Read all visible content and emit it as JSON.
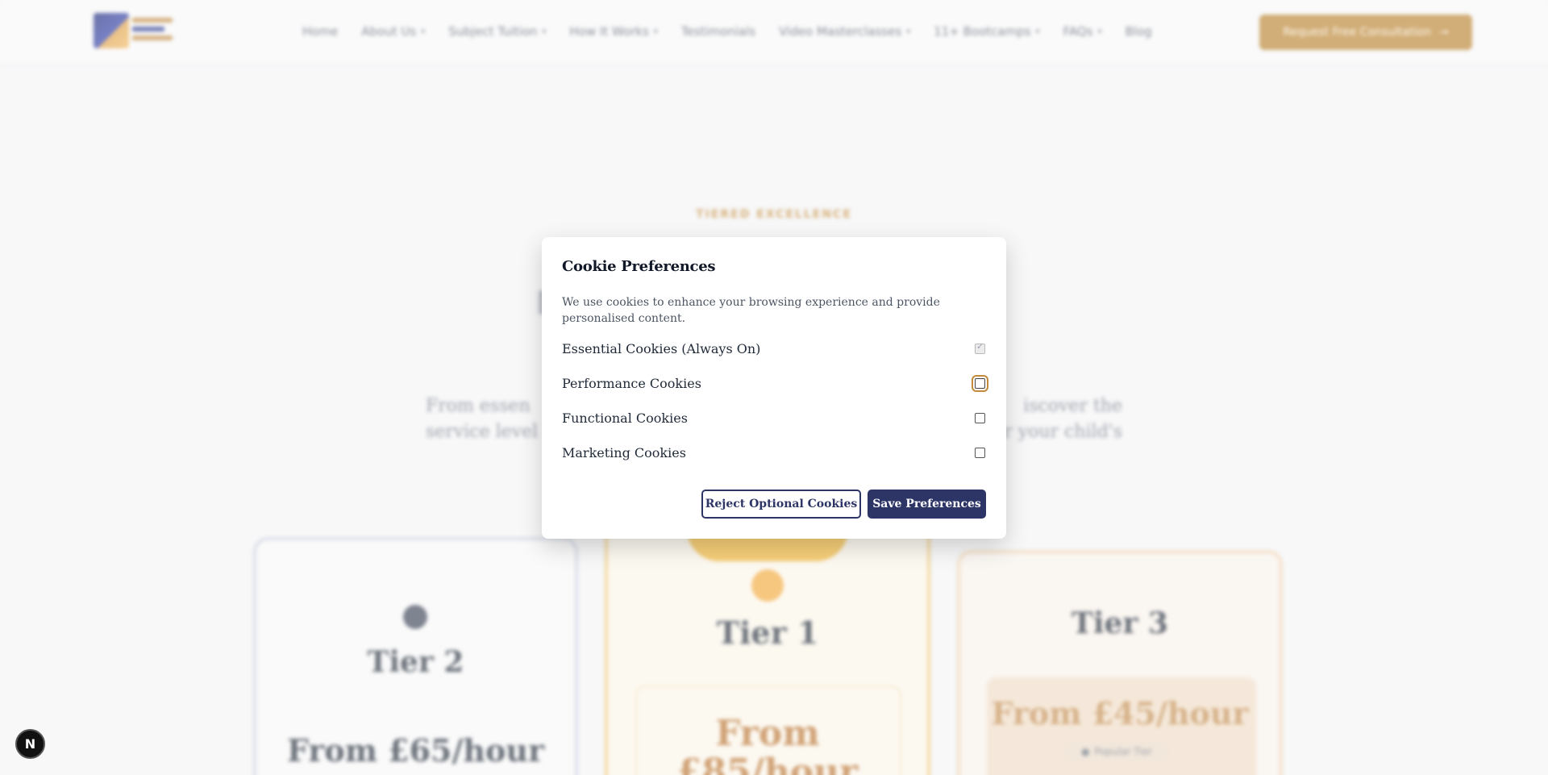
{
  "header": {
    "nav": [
      {
        "label": "Home",
        "chevron": false
      },
      {
        "label": "About Us",
        "chevron": true
      },
      {
        "label": "Subject Tuition",
        "chevron": true
      },
      {
        "label": "How It Works",
        "chevron": true
      },
      {
        "label": "Testimonials",
        "chevron": false
      },
      {
        "label": "Video Masterclasses",
        "chevron": true
      },
      {
        "label": "11+ Bootcamps",
        "chevron": true
      },
      {
        "label": "FAQs",
        "chevron": true
      },
      {
        "label": "Blog",
        "chevron": false
      }
    ],
    "cta_label": "Request Free Consultation",
    "cta_icon": "arrow-right-icon"
  },
  "hero": {
    "eyebrow": "TIERED EXCELLENCE",
    "intro_left_1": "From essen",
    "intro_right_1": "iscover the",
    "intro_left_2": "service level",
    "intro_right_2": "r your child's"
  },
  "tiers": [
    {
      "name": "Tier 2",
      "price": "From £65/hour"
    },
    {
      "name": "Tier 1",
      "price_line1": "From",
      "price_line2": "£85/hour"
    },
    {
      "name": "Tier 3",
      "price": "From £45/hour",
      "pill": "Popular Tier"
    }
  ],
  "modal": {
    "title": "Cookie Preferences",
    "description": "We use cookies to enhance your browsing experience and provide personalised content.",
    "options": [
      {
        "label": "Essential Cookies (Always On)",
        "checked": true,
        "disabled": true
      },
      {
        "label": "Performance Cookies",
        "checked": false,
        "focused": true
      },
      {
        "label": "Functional Cookies",
        "checked": false
      },
      {
        "label": "Marketing Cookies",
        "checked": false
      }
    ],
    "reject_label": "Reject Optional Cookies",
    "save_label": "Save Preferences"
  },
  "dev_badge": "N",
  "colors": {
    "primary": "#2d3566",
    "accent": "#c28a3a",
    "gold": "#f2b531"
  }
}
